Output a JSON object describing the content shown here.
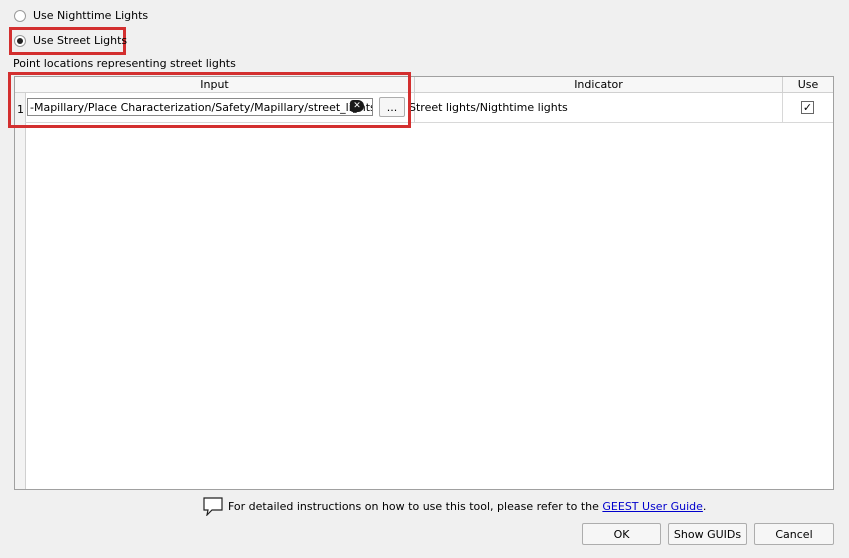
{
  "options": {
    "nighttime_label": "Use Nighttime Lights",
    "street_label": "Use Street Lights"
  },
  "description": "Point locations representing street lights",
  "table": {
    "headers": [
      "Input",
      "Indicator",
      "Use"
    ],
    "row": {
      "number": "1",
      "path": "-Mapillary/Place Characterization/Safety/Mapillary/street_lights.shp",
      "browse_label": "...",
      "indicator": "Street lights/Nigthtime lights",
      "use_checked": true,
      "check_glyph": "✓"
    }
  },
  "footer": {
    "help_text": "For detailed instructions on how to use this tool, please refer to the",
    "link_text": "GEEST User Guide",
    "period": ".",
    "ok_label": "OK",
    "guids_label": "Show GUIDs",
    "cancel_label": "Cancel"
  },
  "icons": {
    "clear": "clear-icon",
    "help": "speech-bubble-icon"
  }
}
